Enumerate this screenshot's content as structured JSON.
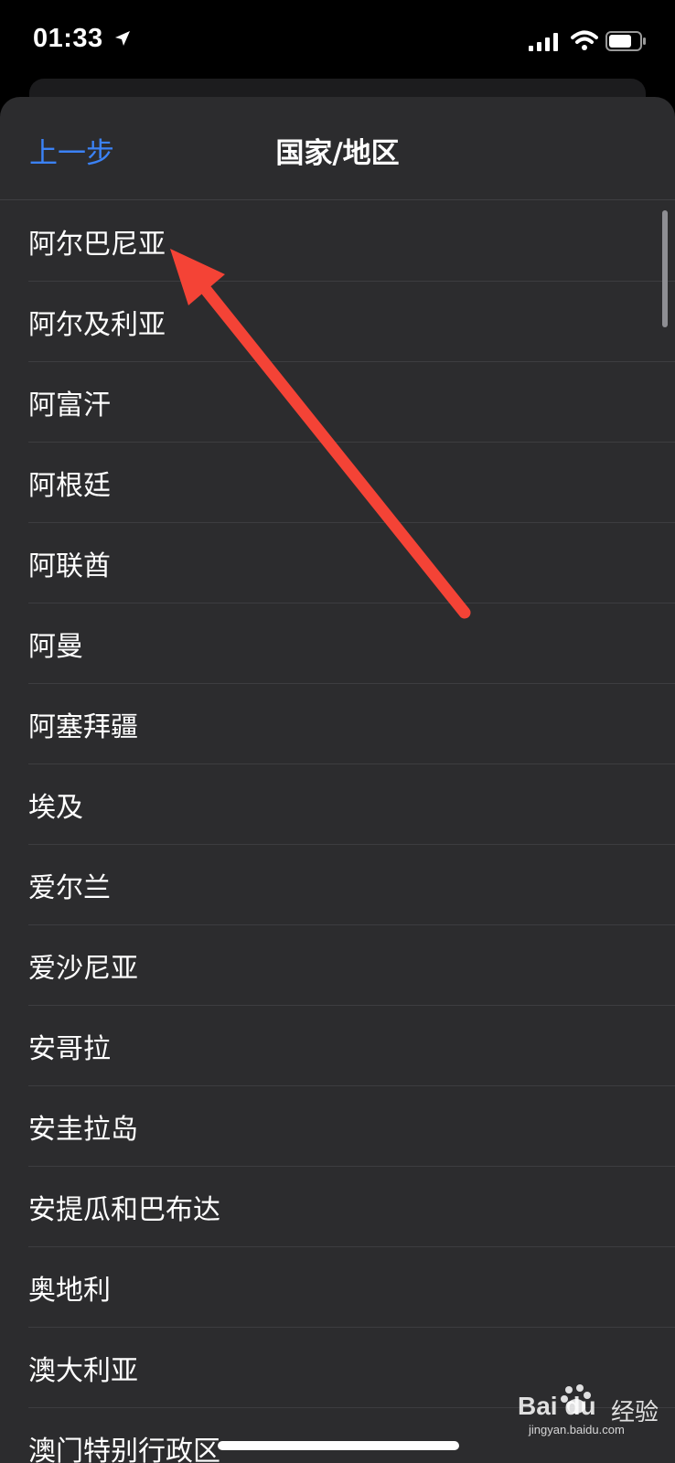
{
  "status_bar": {
    "time": "01:33",
    "icons": [
      "location-arrow-icon",
      "cellular-signal-icon",
      "wifi-icon",
      "battery-icon"
    ]
  },
  "nav": {
    "back_label": "上一步",
    "title": "国家/地区"
  },
  "countries": [
    "阿尔巴尼亚",
    "阿尔及利亚",
    "阿富汗",
    "阿根廷",
    "阿联酋",
    "阿曼",
    "阿塞拜疆",
    "埃及",
    "爱尔兰",
    "爱沙尼亚",
    "安哥拉",
    "安圭拉岛",
    "安提瓜和巴布达",
    "奥地利",
    "澳大利亚",
    "澳门特别行政区"
  ],
  "watermark": {
    "logo": "Bai du",
    "logo_suffix": "经验",
    "url": "jingyan.baidu.com"
  },
  "colors": {
    "background": "#000000",
    "sheet": "#2c2c2e",
    "accent_blue": "#3b82f6",
    "separator": "#3d3d40",
    "annotation_red": "#f44336"
  }
}
